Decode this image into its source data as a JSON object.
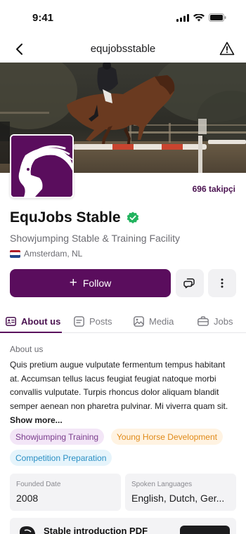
{
  "status_bar": {
    "time": "9:41"
  },
  "nav": {
    "title": "equjobsstable",
    "back_icon": "chevron-left-icon",
    "report_icon": "warning-triangle-icon"
  },
  "profile": {
    "followers": "696 takipçi",
    "name": "EquJobs Stable",
    "verified_color": "#22b35e",
    "subtitle": "Showjumping Stable & Training Facility",
    "location": "Amsterdam, NL",
    "flag": [
      "#ae1c28",
      "#ffffff",
      "#21468b"
    ]
  },
  "actions": {
    "follow_label": "Follow",
    "message_icon": "chat-bubbles-icon",
    "more_icon": "more-vertical-icon"
  },
  "tabs": [
    {
      "label": "About us",
      "icon": "id-card-icon",
      "active": true
    },
    {
      "label": "Posts",
      "icon": "post-icon",
      "active": false
    },
    {
      "label": "Media",
      "icon": "image-icon",
      "active": false
    },
    {
      "label": "Jobs",
      "icon": "briefcase-icon",
      "active": false
    }
  ],
  "about": {
    "label": "About us",
    "lines": [
      "Quis pretium augue vulputate fermentum tempus habitant",
      "at. Accumsan tellus lacus feugiat feugiat natoque morbi",
      "convallis vulputate. Turpis rhoncus dolor aliquam blandit",
      "semper aenean non pharetra pulvinar. Mi viverra quam sit."
    ],
    "show_more": "Show more..."
  },
  "tags": [
    "Showjumping Training",
    "Young Horse Development",
    "Competition Preparation"
  ],
  "info_cards": [
    {
      "label": "Founded Date",
      "value": "2008"
    },
    {
      "label": "Spoken Languages",
      "value": "English, Dutch, Ger..."
    }
  ],
  "document": {
    "title": "Stable introduction PDF"
  },
  "colors": {
    "brand": "#5a0d5d",
    "accent_text": "#4a1250"
  }
}
